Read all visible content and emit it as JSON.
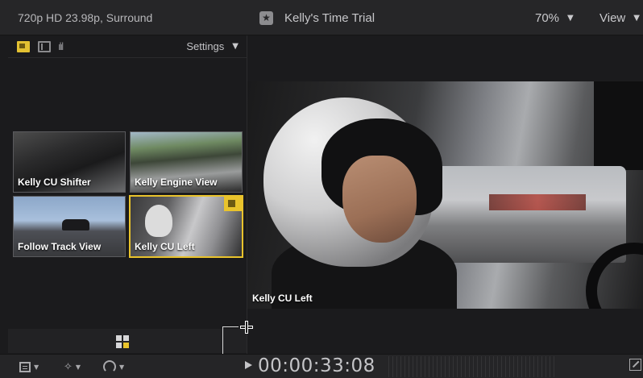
{
  "topbar": {
    "format": "720p HD 23.98p, Surround",
    "title": "Kelly's Time Trial",
    "zoom": "70%",
    "view_label": "View"
  },
  "angle_viewer": {
    "settings_label": "Settings",
    "angles": [
      {
        "label": "Kelly CU Shifter",
        "active": false
      },
      {
        "label": "Kelly Engine View",
        "active": false
      },
      {
        "label": "Follow Track View",
        "active": false
      },
      {
        "label": "Kelly CU Left",
        "active": true
      }
    ]
  },
  "viewer": {
    "clip_label": "Kelly CU Left"
  },
  "bottombar": {
    "timecode": "00:00:33:08"
  },
  "colors": {
    "accent": "#e9c32c",
    "background": "#1b1b1d"
  }
}
